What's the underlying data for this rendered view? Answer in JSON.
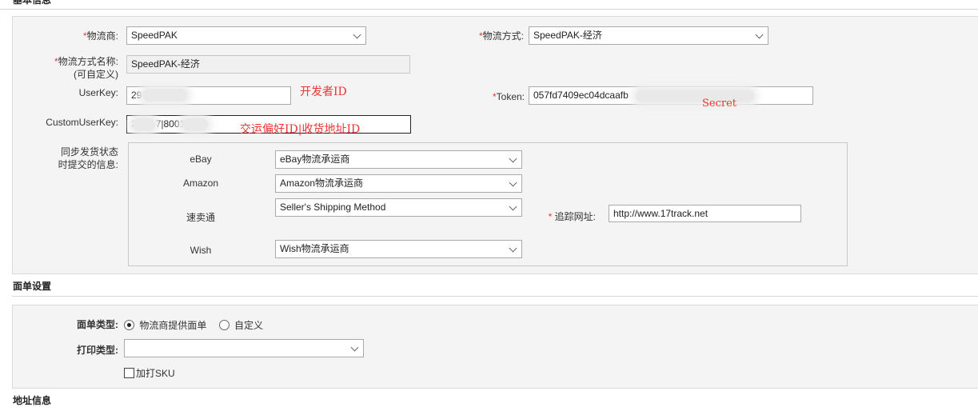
{
  "sections": {
    "basic_title": "基本信息",
    "form_title": "面单设置",
    "address_title": "地址信息"
  },
  "carrier": {
    "required_mark": "*",
    "label": "物流商:",
    "value": "SpeedPAK"
  },
  "method": {
    "required_mark": "*",
    "label": "物流方式:",
    "value": "SpeedPAK-经济"
  },
  "method_name": {
    "required_mark": "*",
    "label_line1": "物流方式名称:",
    "label_line2": "(可自定义)",
    "value": "SpeedPAK-经济"
  },
  "user_key": {
    "label": "UserKey:",
    "value": "29",
    "annotation": "开发者ID"
  },
  "token": {
    "required_mark": "*",
    "label": "Token:",
    "value": "057fd7409ec04dcaafb",
    "annotation": "Secret"
  },
  "custom_user_key": {
    "label": "CustomUserKey:",
    "value_a": "2",
    "value_b": "7|8001",
    "annotation": "交运偏好ID|收货地址ID"
  },
  "sync": {
    "label_line1": "同步发货状态",
    "label_line2": "时提交的信息:",
    "rows": [
      {
        "platform": "eBay",
        "value": "eBay物流承运商"
      },
      {
        "platform": "Amazon",
        "value": "Amazon物流承运商"
      },
      {
        "platform": "速卖通",
        "value": "Seller's Shipping Method"
      },
      {
        "platform": "Wish",
        "value": "Wish物流承运商"
      }
    ],
    "tracking_required_mark": "*",
    "tracking_label": "追踪网址:",
    "tracking_value": "http://www.17track.net"
  },
  "label_settings": {
    "type_label": "面单类型:",
    "option_carrier": "物流商提供面单",
    "option_custom": "自定义",
    "selected": "物流商提供面单",
    "print_label": "打印类型:",
    "print_value": "",
    "sku_checkbox": "加打SKU",
    "sku_checked": false
  }
}
